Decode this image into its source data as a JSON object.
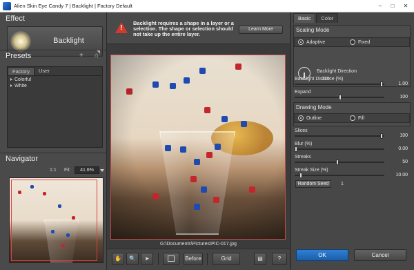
{
  "window": {
    "title": "Alien Skin Eye Candy 7 | Backlight | Factory Default",
    "minimize": "–",
    "maximize": "□",
    "close": "✕"
  },
  "left": {
    "effect_title": "Effect",
    "effect_name": "Backlight",
    "presets_title": "Presets",
    "preset_tabs": [
      "Factory",
      "User"
    ],
    "preset_items": [
      "Colorful",
      "White"
    ],
    "add_icon": "+",
    "home_icon": "⌂",
    "navigator_title": "Navigator",
    "zoom_1to1": "1:1",
    "zoom_fit": "Fit",
    "zoom_value": "41.6%"
  },
  "message": {
    "text": "Backlight requires a shape in a layer or a selection. The shape or selection should not take up the entire layer.",
    "learn_more": "Learn More"
  },
  "canvas": {
    "path": "G:\\Documents\\Pictures\\PIC-017.jpg"
  },
  "toolbar": {
    "hand_icon": "✋",
    "zoom_icon": "🔍",
    "pointer_icon": "➤",
    "before": "Before",
    "grid": "Grid",
    "help_icon": "?"
  },
  "right": {
    "tabs": [
      "Basic",
      "Color"
    ],
    "scaling_mode": {
      "title": "Scaling Mode",
      "options": [
        "Adaptive",
        "Fixed"
      ],
      "selected": "Adaptive"
    },
    "backlight_direction": {
      "label": "Backlight Direction",
      "value": "270"
    },
    "params_a": [
      {
        "label": "Backlight Distance (%)",
        "value": "1.00",
        "fraction": 0.98
      },
      {
        "label": "Expand",
        "value": "100",
        "fraction": 0.5
      }
    ],
    "drawing_mode": {
      "title": "Drawing Mode",
      "options": [
        "Outline",
        "Fill"
      ],
      "selected": "Outline"
    },
    "params_b": [
      {
        "label": "Slices",
        "value": "100",
        "fraction": 0.98
      },
      {
        "label": "Blur (%)",
        "value": "0.00",
        "fraction": 0.0
      },
      {
        "label": "Streaks",
        "value": "50",
        "fraction": 0.47
      },
      {
        "label": "Streak Size (%)",
        "value": "10.00",
        "fraction": 0.06
      }
    ],
    "random_seed": {
      "label": "Random Seed",
      "value": "1"
    },
    "ok": "OK",
    "cancel": "Cancel"
  },
  "colors": {
    "accent": "#1b5ea8",
    "warning": "#d33a2c",
    "die_red": "#c4262e",
    "die_blue": "#1f4bb0"
  }
}
